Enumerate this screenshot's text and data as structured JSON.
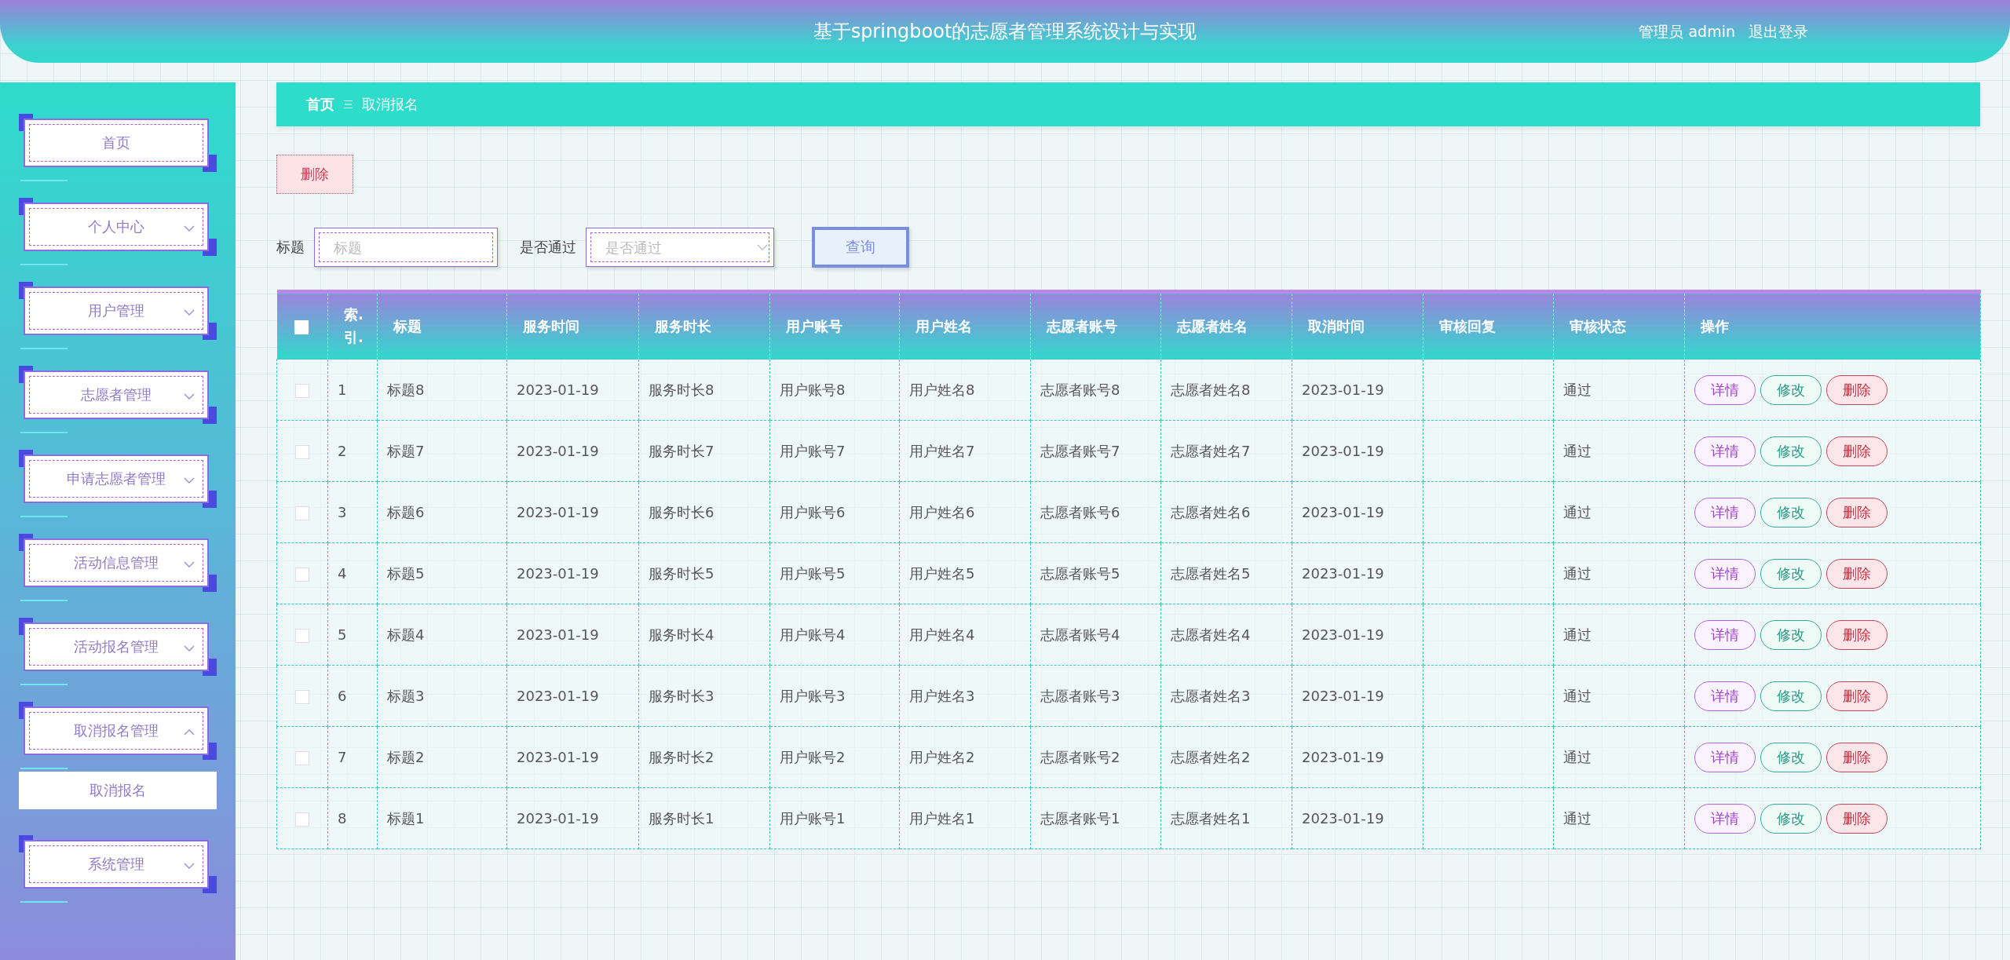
{
  "header": {
    "title": "基于springboot的志愿者管理系统设计与实现",
    "user": "管理员 admin",
    "logout": "退出登录"
  },
  "sidebar": {
    "items": [
      {
        "kind": "link",
        "label": "首页"
      },
      {
        "kind": "menu",
        "label": "个人中心",
        "expanded": false
      },
      {
        "kind": "menu",
        "label": "用户管理",
        "expanded": false
      },
      {
        "kind": "menu",
        "label": "志愿者管理",
        "expanded": false
      },
      {
        "kind": "menu",
        "label": "申请志愿者管理",
        "expanded": false
      },
      {
        "kind": "menu",
        "label": "活动信息管理",
        "expanded": false
      },
      {
        "kind": "menu",
        "label": "活动报名管理",
        "expanded": false
      },
      {
        "kind": "menu",
        "label": "取消报名管理",
        "expanded": true,
        "children": [
          {
            "label": "取消报名",
            "selected": true
          }
        ]
      },
      {
        "kind": "menu",
        "label": "系统管理",
        "expanded": false
      }
    ]
  },
  "breadcrumb": {
    "home": "首页",
    "current": "取消报名"
  },
  "toolbar": {
    "delete": "删除"
  },
  "search": {
    "fields": [
      {
        "kind": "input",
        "label": "标题",
        "placeholder": "标题"
      },
      {
        "kind": "select",
        "label": "是否通过",
        "placeholder": "是否通过"
      }
    ],
    "button": "查询"
  },
  "table": {
    "select_all": {
      "checked": false
    },
    "columns": [
      "索.引.",
      "标题",
      "服务时间",
      "服务时长",
      "用户账号",
      "用户姓名",
      "志愿者账号",
      "志愿者姓名",
      "取消时间",
      "审核回复",
      "审核状态",
      "操作"
    ],
    "rows": [
      {
        "checked": false,
        "cells": [
          "1",
          "标题8",
          "2023-01-19",
          "服务时长8",
          "用户账号8",
          "用户姓名8",
          "志愿者账号8",
          "志愿者姓名8",
          "2023-01-19",
          "",
          "通过"
        ],
        "actions": [
          {
            "kind": "detail",
            "label": "详情"
          },
          {
            "kind": "edit",
            "label": "修改"
          },
          {
            "kind": "delete",
            "label": "删除"
          }
        ]
      },
      {
        "checked": false,
        "cells": [
          "2",
          "标题7",
          "2023-01-19",
          "服务时长7",
          "用户账号7",
          "用户姓名7",
          "志愿者账号7",
          "志愿者姓名7",
          "2023-01-19",
          "",
          "通过"
        ],
        "actions": [
          {
            "kind": "detail",
            "label": "详情"
          },
          {
            "kind": "edit",
            "label": "修改"
          },
          {
            "kind": "delete",
            "label": "删除"
          }
        ]
      },
      {
        "checked": false,
        "cells": [
          "3",
          "标题6",
          "2023-01-19",
          "服务时长6",
          "用户账号6",
          "用户姓名6",
          "志愿者账号6",
          "志愿者姓名6",
          "2023-01-19",
          "",
          "通过"
        ],
        "actions": [
          {
            "kind": "detail",
            "label": "详情"
          },
          {
            "kind": "edit",
            "label": "修改"
          },
          {
            "kind": "delete",
            "label": "删除"
          }
        ]
      },
      {
        "checked": false,
        "cells": [
          "4",
          "标题5",
          "2023-01-19",
          "服务时长5",
          "用户账号5",
          "用户姓名5",
          "志愿者账号5",
          "志愿者姓名5",
          "2023-01-19",
          "",
          "通过"
        ],
        "actions": [
          {
            "kind": "detail",
            "label": "详情"
          },
          {
            "kind": "edit",
            "label": "修改"
          },
          {
            "kind": "delete",
            "label": "删除"
          }
        ]
      },
      {
        "checked": false,
        "cells": [
          "5",
          "标题4",
          "2023-01-19",
          "服务时长4",
          "用户账号4",
          "用户姓名4",
          "志愿者账号4",
          "志愿者姓名4",
          "2023-01-19",
          "",
          "通过"
        ],
        "actions": [
          {
            "kind": "detail",
            "label": "详情"
          },
          {
            "kind": "edit",
            "label": "修改"
          },
          {
            "kind": "delete",
            "label": "删除"
          }
        ]
      },
      {
        "checked": false,
        "cells": [
          "6",
          "标题3",
          "2023-01-19",
          "服务时长3",
          "用户账号3",
          "用户姓名3",
          "志愿者账号3",
          "志愿者姓名3",
          "2023-01-19",
          "",
          "通过"
        ],
        "actions": [
          {
            "kind": "detail",
            "label": "详情"
          },
          {
            "kind": "edit",
            "label": "修改"
          },
          {
            "kind": "delete",
            "label": "删除"
          }
        ]
      },
      {
        "checked": false,
        "cells": [
          "7",
          "标题2",
          "2023-01-19",
          "服务时长2",
          "用户账号2",
          "用户姓名2",
          "志愿者账号2",
          "志愿者姓名2",
          "2023-01-19",
          "",
          "通过"
        ],
        "actions": [
          {
            "kind": "detail",
            "label": "详情"
          },
          {
            "kind": "edit",
            "label": "修改"
          },
          {
            "kind": "delete",
            "label": "删除"
          }
        ]
      },
      {
        "checked": false,
        "cells": [
          "8",
          "标题1",
          "2023-01-19",
          "服务时长1",
          "用户账号1",
          "用户姓名1",
          "志愿者账号1",
          "志愿者姓名1",
          "2023-01-19",
          "",
          "通过"
        ],
        "actions": [
          {
            "kind": "detail",
            "label": "详情"
          },
          {
            "kind": "edit",
            "label": "修改"
          },
          {
            "kind": "delete",
            "label": "删除"
          }
        ]
      }
    ]
  }
}
